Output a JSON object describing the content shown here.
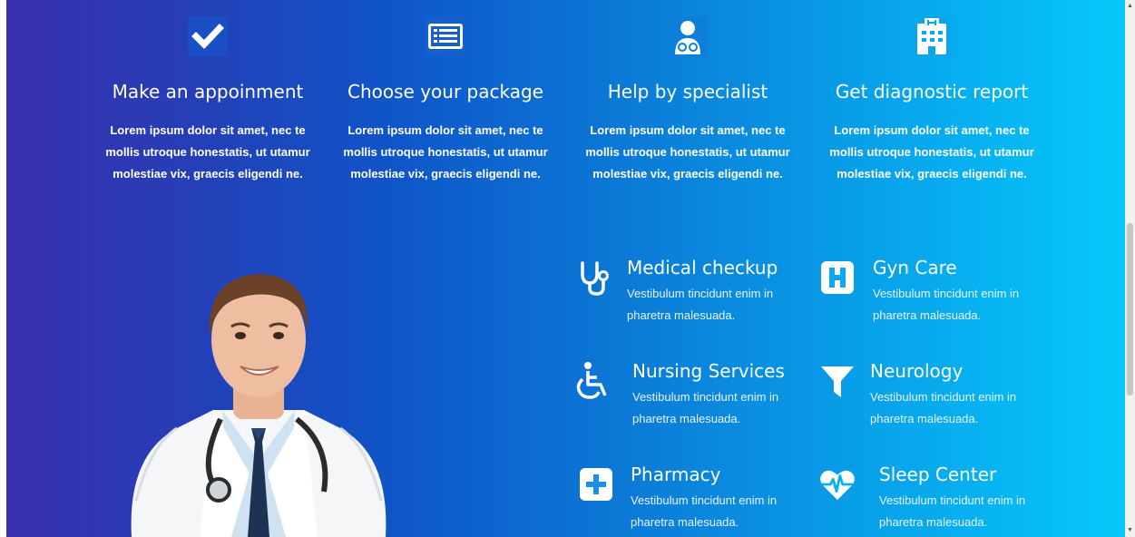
{
  "steps": [
    {
      "icon": "checkmark-icon",
      "title": "Make an appoinment",
      "text": "Lorem ipsum dolor sit amet, nec te mollis utroque honestatis, ut utamur molestiae vix, graecis eligendi ne."
    },
    {
      "icon": "list-icon",
      "title": "Choose your package",
      "text": "Lorem ipsum dolor sit amet, nec te mollis utroque honestatis, ut utamur molestiae vix, graecis eligendi ne."
    },
    {
      "icon": "doctor-icon",
      "title": "Help by specialist",
      "text": "Lorem ipsum dolor sit amet, nec te mollis utroque honestatis, ut utamur molestiae vix, graecis eligendi ne."
    },
    {
      "icon": "hospital-building-icon",
      "title": "Get diagnostic report",
      "text": "Lorem ipsum dolor sit amet, nec te mollis utroque honestatis, ut utamur molestiae vix, graecis eligendi ne."
    }
  ],
  "services": [
    {
      "icon": "stethoscope-icon",
      "title": "Medical checkup",
      "text": "Vestibulum tincidunt enim in pharetra malesuada."
    },
    {
      "icon": "h-square-icon",
      "title": "Gyn Care",
      "text": "Vestibulum tincidunt enim in pharetra malesuada."
    },
    {
      "icon": "wheelchair-icon",
      "title": "Nursing Services",
      "text": "Vestibulum tincidunt enim in pharetra malesuada."
    },
    {
      "icon": "funnel-icon",
      "title": "Neurology",
      "text": "Vestibulum tincidunt enim in pharetra malesuada."
    },
    {
      "icon": "plus-square-icon",
      "title": "Pharmacy",
      "text": "Vestibulum tincidunt enim in pharetra malesuada."
    },
    {
      "icon": "heartbeat-icon",
      "title": "Sleep Center",
      "text": "Vestibulum tincidunt enim in pharetra malesuada."
    }
  ],
  "colors": {
    "gradient_start": "#3a2fae",
    "gradient_end": "#06c8fb",
    "text": "#ffffff"
  }
}
